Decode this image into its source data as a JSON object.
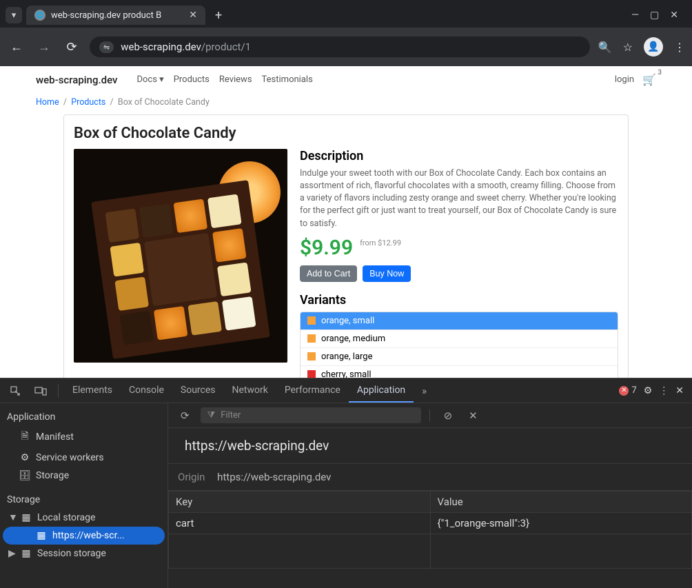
{
  "browser": {
    "tab_title": "web-scraping.dev product B",
    "url_host": "web-scraping.dev",
    "url_path": "/product/1"
  },
  "nav": {
    "brand": "web-scraping.dev",
    "links": [
      "Docs",
      "Products",
      "Reviews",
      "Testimonials"
    ],
    "login": "login",
    "cart_count": "3"
  },
  "breadcrumb": {
    "home": "Home",
    "products": "Products",
    "current": "Box of Chocolate Candy"
  },
  "product": {
    "title": "Box of Chocolate Candy",
    "desc_heading": "Description",
    "desc_text": "Indulge your sweet tooth with our Box of Chocolate Candy. Each box contains an assortment of rich, flavorful chocolates with a smooth, creamy filling. Choose from a variety of flavors including zesty orange and sweet cherry. Whether you're looking for the perfect gift or just want to treat yourself, our Box of Chocolate Candy is sure to satisfy.",
    "price": "$9.99",
    "price_from": "from $12.99",
    "add_to_cart": "Add to Cart",
    "buy_now": "Buy Now",
    "variants_heading": "Variants",
    "variants": [
      {
        "label": "orange, small",
        "swatch": "sw-orange",
        "selected": true
      },
      {
        "label": "orange, medium",
        "swatch": "sw-orange",
        "selected": false
      },
      {
        "label": "orange, large",
        "swatch": "sw-orange",
        "selected": false
      },
      {
        "label": "cherry, small",
        "swatch": "sw-cherry",
        "selected": false
      }
    ]
  },
  "devtools": {
    "tabs": [
      "Elements",
      "Console",
      "Sources",
      "Network",
      "Performance",
      "Application"
    ],
    "active_tab": "Application",
    "error_count": "7",
    "filter_placeholder": "Filter",
    "side": {
      "app_heading": "Application",
      "manifest": "Manifest",
      "service_workers": "Service workers",
      "storage_item": "Storage",
      "storage_heading": "Storage",
      "local_storage": "Local storage",
      "local_storage_origin": "https://web-scr...",
      "session_storage": "Session storage"
    },
    "main": {
      "title": "https://web-scraping.dev",
      "origin_label": "Origin",
      "origin_value": "https://web-scraping.dev",
      "key_header": "Key",
      "value_header": "Value",
      "rows": [
        {
          "key": "cart",
          "value": "{\"1_orange-small\":3}"
        }
      ]
    }
  }
}
